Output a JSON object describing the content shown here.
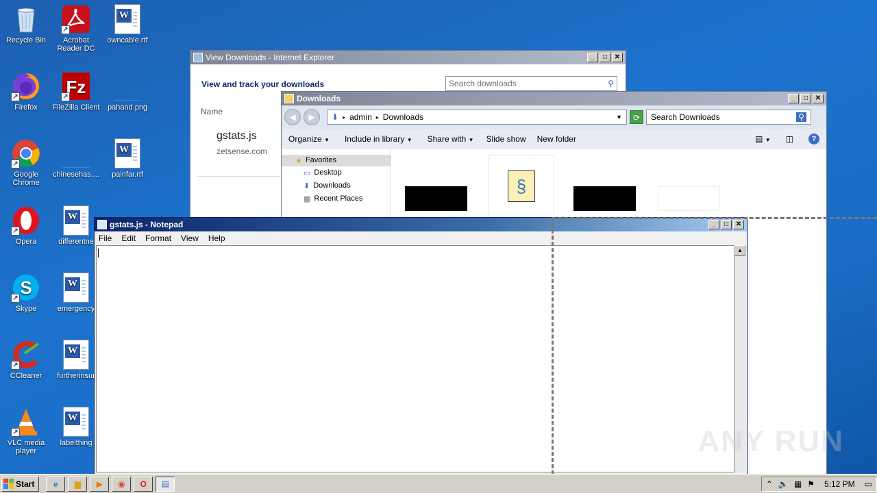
{
  "desktop": {
    "icons": [
      {
        "label": "Recycle Bin"
      },
      {
        "label": "Acrobat Reader DC"
      },
      {
        "label": "owncable.rtf"
      },
      {
        "label": "Firefox"
      },
      {
        "label": "FileZilla Client"
      },
      {
        "label": "pahand.png"
      },
      {
        "label": "Google Chrome"
      },
      {
        "label": "chinesehas...."
      },
      {
        "label": "painfar.rtf"
      },
      {
        "label": "Opera"
      },
      {
        "label": "differentne"
      },
      {
        "label": "Skype"
      },
      {
        "label": "emergency"
      },
      {
        "label": "CCleaner"
      },
      {
        "label": "furtherinsur"
      },
      {
        "label": "VLC media player"
      },
      {
        "label": "labelthing"
      }
    ]
  },
  "ie_downloads": {
    "title": "View Downloads - Internet Explorer",
    "heading": "View and track your downloads",
    "search_placeholder": "Search downloads",
    "column_name": "Name",
    "item": {
      "name": "gstats.js",
      "source": "zetsense.com"
    }
  },
  "explorer": {
    "title": "Downloads",
    "breadcrumb": [
      "admin",
      "Downloads"
    ],
    "search_placeholder": "Search Downloads",
    "toolbar": {
      "organize": "Organize",
      "include": "Include in library",
      "share": "Share with",
      "slideshow": "Slide show",
      "newfolder": "New folder"
    },
    "nav": {
      "favorites": "Favorites",
      "desktop": "Desktop",
      "downloads": "Downloads",
      "recent": "Recent Places"
    }
  },
  "notepad": {
    "title": "gstats.js - Notepad",
    "menu": [
      "File",
      "Edit",
      "Format",
      "View",
      "Help"
    ],
    "content": ""
  },
  "taskbar": {
    "start": "Start",
    "clock": "5:12 PM"
  },
  "watermark": "ANY RUN"
}
